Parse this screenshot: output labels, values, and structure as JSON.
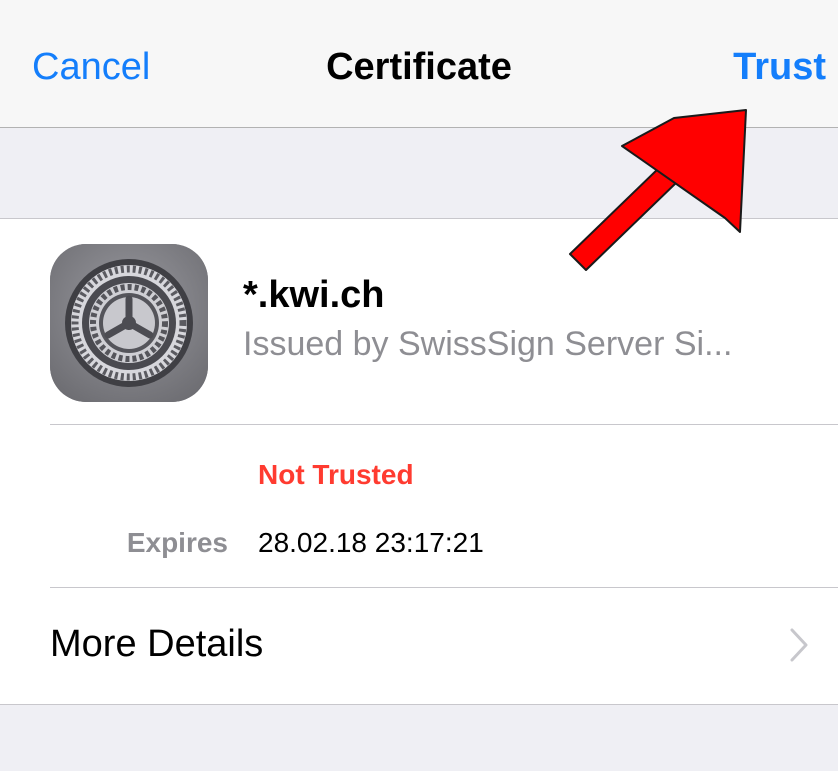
{
  "navbar": {
    "cancel_label": "Cancel",
    "title": "Certificate",
    "trust_label": "Trust"
  },
  "certificate": {
    "name": "*.kwi.ch",
    "issuer": "Issued by SwissSign Server Si...",
    "status": "Not Trusted",
    "expires_label": "Expires",
    "expires_value": "28.02.18 23:17:21"
  },
  "details": {
    "label": "More Details"
  },
  "colors": {
    "accent": "#147efb",
    "status_untrusted": "#ff3b30",
    "annotation_arrow": "#ff0000"
  },
  "icons": {
    "app_icon": "settings-gear-icon",
    "chevron": "chevron-right-icon",
    "annotation": "red-arrow-icon"
  }
}
